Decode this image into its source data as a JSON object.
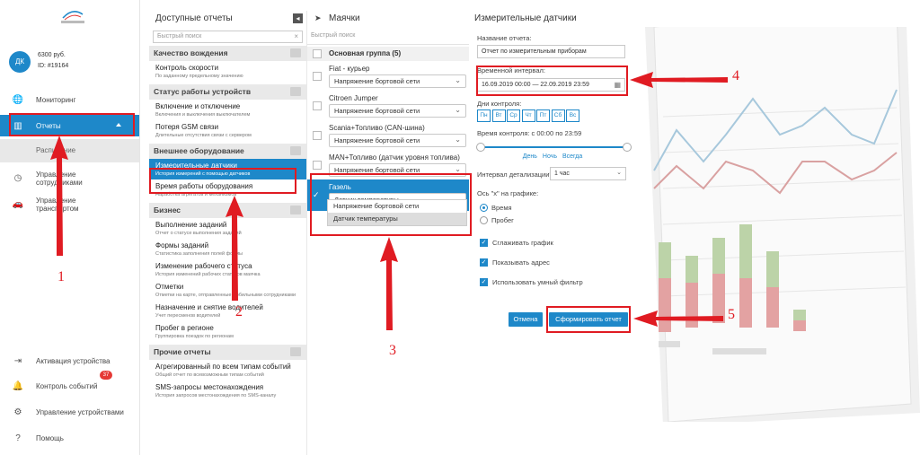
{
  "account": {
    "initials": "ДК",
    "balance": "6300 руб.",
    "id": "ID: #19164"
  },
  "nav": {
    "monitoring": "Мониторинг",
    "reports": "Отчеты",
    "schedule": "Расписание",
    "staff_line1": "Управление",
    "staff_line2": "сотрудниками",
    "transport_line1": "Управление",
    "transport_line2": "транспортом",
    "activation": "Активация устройства",
    "events": "Контроль событий",
    "events_badge": "37",
    "devices": "Управление устройствами",
    "help": "Помощь"
  },
  "reports_panel": {
    "title": "Доступные отчеты",
    "search_placeholder": "Быстрый поиск",
    "categories": [
      {
        "name": "Качество вождения",
        "items": [
          {
            "title": "Контроль скорости",
            "desc": "По заданному предельному значению"
          }
        ]
      },
      {
        "name": "Статус работы устройств",
        "items": [
          {
            "title": "Включение и отключение",
            "desc": "Включения и выключения выключателем"
          },
          {
            "title": "Потеря GSM связи",
            "desc": "Длительные отсутствия связи с сервером"
          }
        ]
      },
      {
        "name": "Внешнее оборудование",
        "items": [
          {
            "title": "Измерительные датчики",
            "desc": "История измерений с помощью датчиков"
          },
          {
            "title": "Время работы оборудования",
            "desc": "Наработка агрегатов и механизмов"
          }
        ]
      },
      {
        "name": "Бизнес",
        "items": [
          {
            "title": "Выполнение заданий",
            "desc": "Отчет о статусе выполнения заданий"
          },
          {
            "title": "Формы заданий",
            "desc": "Статистика заполнения полей формы"
          },
          {
            "title": "Изменение рабочего статуса",
            "desc": "История изменений рабочих статусов маячка"
          },
          {
            "title": "Отметки",
            "desc": "Отметки на карте, отправленные мобильными сотрудниками"
          },
          {
            "title": "Назначение и снятие водителей",
            "desc": "Учет пересменов водителей"
          },
          {
            "title": "Пробег в регионе",
            "desc": "Группировка поездок по регионам"
          }
        ]
      },
      {
        "name": "Прочие отчеты",
        "items": [
          {
            "title": "Агрегированный по всем типам событий",
            "desc": "Общий отчет по всевозможным типам событий"
          },
          {
            "title": "SMS-запросы местонахождения",
            "desc": "История запросов местонахождения по SMS-каналу"
          }
        ]
      }
    ]
  },
  "beacons_panel": {
    "title": "Маячки",
    "search_placeholder": "Быстрый поиск",
    "group": "Основная группа (5)",
    "vehicles": [
      {
        "name": "Fiat - курьер",
        "sensor": "Напряжение бортовой сети"
      },
      {
        "name": "Citroen Jumper",
        "sensor": "Напряжение бортовой сети"
      },
      {
        "name": "Scania+Топливо (CAN-шина)",
        "sensor": "Напряжение бортовой сети"
      },
      {
        "name": "MAN+Топливо (датчик уровня топлива)",
        "sensor": "Напряжение бортовой сети"
      },
      {
        "name": "Газель",
        "sensor": "Датчик температуры"
      }
    ],
    "dropdown_options": [
      "Напряжение бортовой сети",
      "Датчик температуры"
    ]
  },
  "form": {
    "title": "Измерительные датчики",
    "name_label": "Название отчета:",
    "name_value": "Отчет по измерительным приборам",
    "interval_label": "Временной интервал:",
    "interval_value": "16.09.2019 00:00 — 22.09.2019 23:59",
    "days_label": "Дни контроля:",
    "days": [
      "Пн",
      "Вт",
      "Ср",
      "Чт",
      "Пт",
      "Сб",
      "Вс"
    ],
    "control_time": "Время контроля: с 00:00 по 23:59",
    "link_day": "День",
    "link_night": "Ночь",
    "link_always": "Всегда",
    "detail_label": "Интервал детализации*:",
    "detail_value": "1 час",
    "axis_label": "Ось \"x\" на графике:",
    "axis_time": "Время",
    "axis_mileage": "Пробег",
    "smooth": "Сглаживать график",
    "show_address": "Показывать адрес",
    "smart_filter": "Использовать умный фильтр",
    "cancel": "Отмена",
    "submit": "Сформировать отчет"
  },
  "annotations": {
    "n1": "1",
    "n2": "2",
    "n3": "3",
    "n4": "4",
    "n5": "5"
  },
  "colors": {
    "accent": "#1e88c9",
    "annotation": "#e01b22"
  }
}
